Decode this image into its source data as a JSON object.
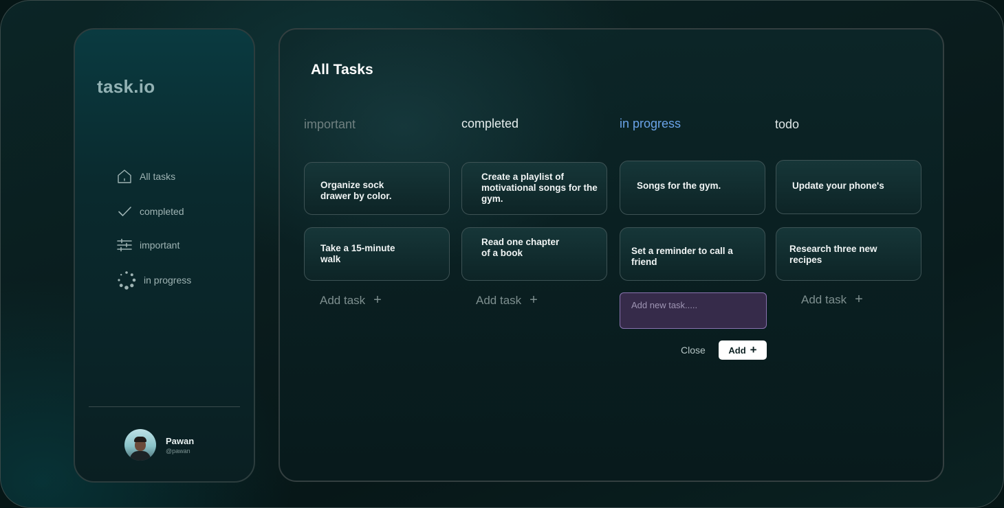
{
  "app": {
    "logo": "task.io"
  },
  "sidebar": {
    "items": [
      {
        "label": "All tasks",
        "icon": "home-icon"
      },
      {
        "label": "completed",
        "icon": "check-icon"
      },
      {
        "label": "important",
        "icon": "sliders-icon"
      },
      {
        "label": "in progress",
        "icon": "spinner-icon"
      }
    ]
  },
  "user": {
    "name": "Pawan",
    "handle": "@pawan"
  },
  "main": {
    "title": "All Tasks"
  },
  "columns": [
    {
      "title": "important",
      "color": "#6f8080",
      "cards": [
        "Organize sock\ndrawer by color.",
        "Take a 15-minute\nwalk"
      ],
      "add_label": "Add task",
      "add_icon": "+"
    },
    {
      "title": "completed",
      "color": "#e6eeee",
      "cards": [
        "Create a playlist of\nmotivational songs for the\ngym.",
        "Read one chapter\nof a book"
      ],
      "add_label": "Add task",
      "add_icon": "+"
    },
    {
      "title": "in progress",
      "color": "#6aa3e8",
      "cards": [
        "Songs for the gym.",
        "Set a reminder to call a\nfriend"
      ],
      "new_task_placeholder": "Add new task.....",
      "close_label": "Close",
      "add_button_label": "Add",
      "add_button_icon": "+"
    },
    {
      "title": "todo",
      "color": "#dfe7e7",
      "cards": [
        "Update your phone's",
        "Research three new\nrecipes"
      ],
      "add_label": "Add task",
      "add_icon": "+"
    }
  ],
  "colors": {
    "accent_in_progress": "#6aa3e8",
    "input_bg": "#362b4a",
    "input_border": "#8a73b0"
  }
}
